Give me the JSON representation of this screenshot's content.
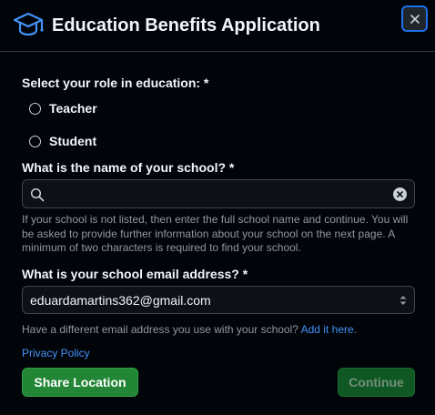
{
  "header": {
    "title": "Education Benefits Application",
    "icon": "graduation-cap-icon",
    "close_icon": "close-icon"
  },
  "role": {
    "label": "Select your role in education: *",
    "options": [
      "Teacher",
      "Student"
    ]
  },
  "school": {
    "label": "What is the name of your school? *",
    "value": "",
    "help": "If your school is not listed, then enter the full school name and continue. You will be asked to provide further information about your school on the next page. A minimum of two characters is required to find your school."
  },
  "email": {
    "label": "What is your school email address? *",
    "value": "eduardamartins362@gmail.com",
    "help_prefix": "Have a different email address you use with your school?",
    "help_link": "Add it here."
  },
  "privacy_link": "Privacy Policy",
  "buttons": {
    "share_location": "Share Location",
    "continue": "Continue"
  },
  "colors": {
    "accent_blue": "#1f6feb",
    "link": "#4493f8",
    "primary_green": "#238636",
    "disabled_green": "#105823",
    "background": "#010409"
  }
}
